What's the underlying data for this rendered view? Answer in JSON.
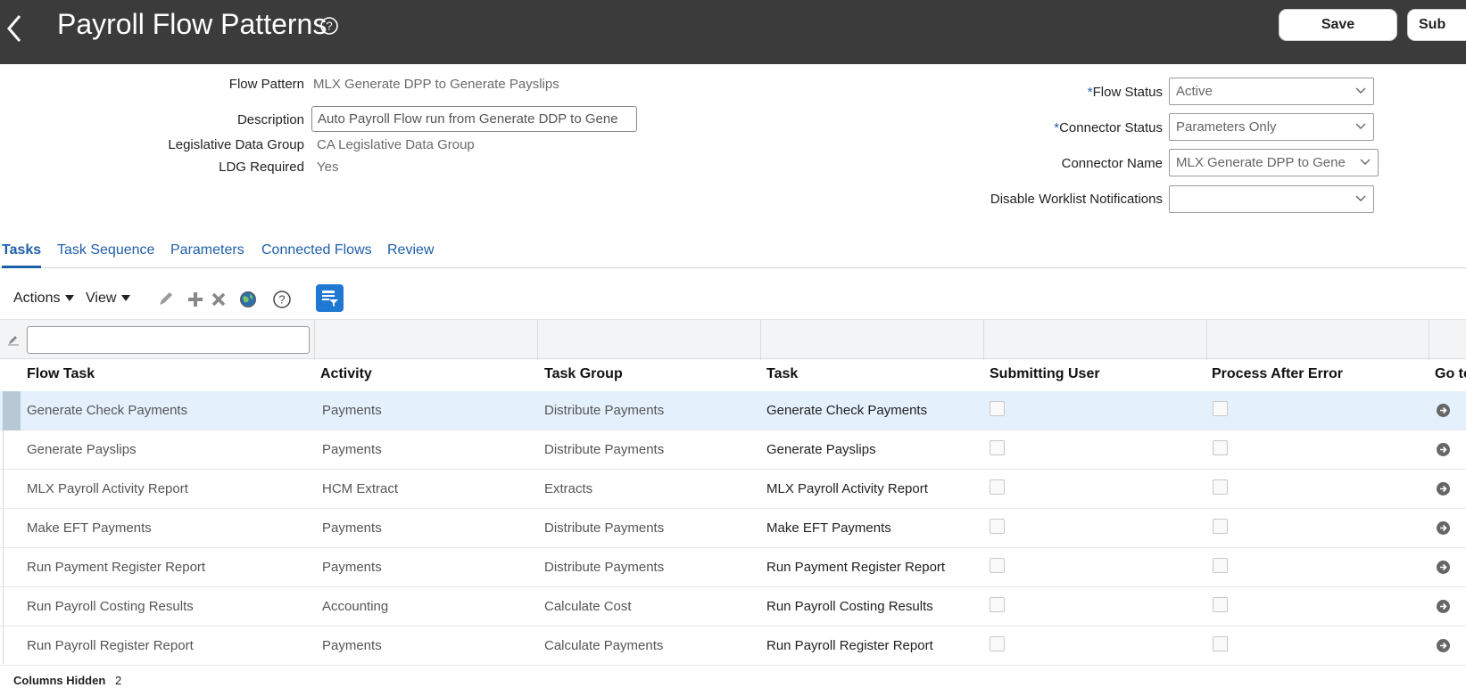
{
  "header": {
    "title": "Payroll Flow Patterns",
    "save_label": "Save",
    "submit_label": "Sub"
  },
  "form": {
    "flow_pattern": {
      "label": "Flow Pattern",
      "value": "MLX Generate DPP to Generate Payslips"
    },
    "description": {
      "label": "Description",
      "value": "Auto Payroll Flow run from Generate DDP to Gene"
    },
    "ldg": {
      "label": "Legislative Data Group",
      "value": "CA Legislative Data Group"
    },
    "ldg_required": {
      "label": "LDG Required",
      "value": "Yes"
    },
    "flow_status": {
      "required_mark": "*",
      "label": "Flow Status",
      "value": "Active"
    },
    "connector_status": {
      "required_mark": "*",
      "label": "Connector Status",
      "value": "Parameters Only"
    },
    "connector_name": {
      "label": "Connector Name",
      "value": "MLX Generate DPP to Gene"
    },
    "disable_worklist": {
      "label": "Disable Worklist Notifications",
      "value": ""
    }
  },
  "tabs": [
    {
      "label": "Tasks",
      "active": true
    },
    {
      "label": "Task Sequence",
      "active": false
    },
    {
      "label": "Parameters",
      "active": false
    },
    {
      "label": "Connected Flows",
      "active": false
    },
    {
      "label": "Review",
      "active": false
    }
  ],
  "toolbar": {
    "actions_label": "Actions",
    "view_label": "View",
    "icons": [
      "edit-icon",
      "add-icon",
      "delete-icon",
      "globe-icon",
      "help-icon",
      "filter-icon"
    ]
  },
  "table": {
    "columns": [
      "Flow Task",
      "Activity",
      "Task Group",
      "Task",
      "Submitting User",
      "Process After Error",
      "Go to"
    ],
    "rows": [
      {
        "flow_task": "Generate Check Payments",
        "activity": "Payments",
        "task_group": "Distribute Payments",
        "task": "Generate Check Payments",
        "selected": true
      },
      {
        "flow_task": "Generate Payslips",
        "activity": "Payments",
        "task_group": "Distribute Payments",
        "task": "Generate Payslips",
        "selected": false
      },
      {
        "flow_task": "MLX Payroll Activity Report",
        "activity": "HCM Extract",
        "task_group": "Extracts",
        "task": "MLX Payroll Activity Report",
        "selected": false
      },
      {
        "flow_task": "Make EFT Payments",
        "activity": "Payments",
        "task_group": "Distribute Payments",
        "task": "Make EFT Payments",
        "selected": false
      },
      {
        "flow_task": "Run Payment Register Report",
        "activity": "Payments",
        "task_group": "Distribute Payments",
        "task": "Run Payment Register Report",
        "selected": false
      },
      {
        "flow_task": "Run Payroll Costing Results",
        "activity": "Accounting",
        "task_group": "Calculate Cost",
        "task": "Run Payroll Costing Results",
        "selected": false
      },
      {
        "flow_task": "Run Payroll Register Report",
        "activity": "Payments",
        "task_group": "Calculate Payments",
        "task": "Run Payroll Register Report",
        "selected": false
      }
    ]
  },
  "footer": {
    "columns_hidden_label": "Columns Hidden",
    "columns_hidden_value": "2"
  },
  "colors": {
    "header_bg": "#3b3b3b",
    "link": "#1f5fa9",
    "accent_button": "#1f78d1",
    "selected_row": "#e4f1fc"
  }
}
